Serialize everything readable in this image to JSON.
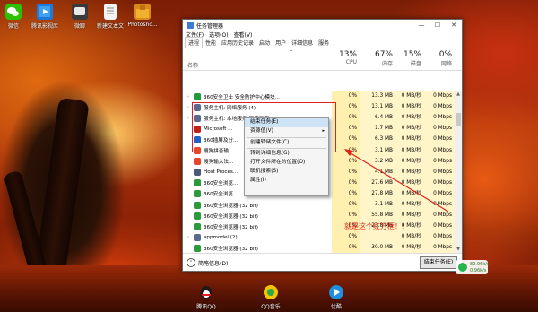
{
  "desktop": {
    "icons": [
      {
        "label": "微信",
        "icon": "wechat-icon",
        "color": "#2dc100"
      },
      {
        "label": "腾讯影视库",
        "icon": "video-library-icon",
        "color": "#1e7ad8"
      },
      {
        "label": "微聊",
        "icon": "chat-icon",
        "color": "#3a3a3a"
      },
      {
        "label": "新建文本文",
        "icon": "text-file-icon",
        "color": "#f4f4f4"
      },
      {
        "label": "Photosho...",
        "icon": "photoshop-icon",
        "color": "#d98a1a"
      },
      {
        "label": "腾讯QQ",
        "icon": "qq-icon",
        "color": "#1a1a1a"
      },
      {
        "label": "QQ音乐",
        "icon": "qq-music-icon",
        "color": "#f5c400"
      },
      {
        "label": "优酷",
        "icon": "youku-icon",
        "color": "#1f8fe0"
      }
    ]
  },
  "window": {
    "title": "任务管理器",
    "controls": {
      "minimize": "—",
      "maximize": "☐",
      "close": "✕"
    },
    "menu": [
      "文件(F)",
      "选项(O)",
      "查看(V)"
    ],
    "tabs": [
      {
        "label": "进程",
        "active": true
      },
      {
        "label": "性能",
        "active": false
      },
      {
        "label": "应用历史记录",
        "active": false
      },
      {
        "label": "启动",
        "active": false
      },
      {
        "label": "用户",
        "active": false
      },
      {
        "label": "详细信息",
        "active": false
      },
      {
        "label": "服务",
        "active": false
      }
    ]
  },
  "columns": {
    "name": "名称",
    "sort_indicator": "^",
    "cpu": {
      "percent": "13%",
      "label": "CPU"
    },
    "memory": {
      "percent": "67%",
      "label": "内存"
    },
    "disk": {
      "percent": "15%",
      "label": "磁盘"
    },
    "network": {
      "percent": "0%",
      "label": "网络"
    }
  },
  "processes": [
    {
      "expander": "›",
      "name": "360安全卫士 安全防护中心模块...",
      "icon": "360-shield-icon",
      "icon_color": "#1e9b3a",
      "cpu": "0%",
      "memory": "13.3 MB",
      "disk": "0 MB/秒",
      "network": "0 Mbps"
    },
    {
      "expander": "›",
      "name": "服务主机: 网络服务 (4)",
      "icon": "service-host-icon",
      "icon_color": "#5a6a8a",
      "cpu": "0%",
      "memory": "13.1 MB",
      "disk": "0 MB/秒",
      "network": "0 Mbps"
    },
    {
      "expander": "›",
      "name": "服务主机: 本地服务(网络受限) (7)",
      "icon": "service-host-icon",
      "icon_color": "#5a6a8a",
      "cpu": "0%",
      "memory": "6.4 MB",
      "disk": "0 MB/秒",
      "network": "0 Mbps"
    },
    {
      "expander": "",
      "name": "Microsoft ...",
      "icon": "red-app-icon",
      "icon_color": "#c0201a",
      "cpu": "0%",
      "memory": "1.7 MB",
      "disk": "0 MB/秒",
      "network": "0 Mbps"
    },
    {
      "expander": "",
      "name": "360插屏及分...",
      "icon": "360-blue-icon",
      "icon_color": "#1c62c8",
      "cpu": "0%",
      "memory": "6.3 MB",
      "disk": "0 MB/秒",
      "network": "0 Mbps"
    },
    {
      "expander": "",
      "name": "搜狗拼音输...",
      "icon": "sogou-icon",
      "icon_color": "#e8452a",
      "cpu": "0%",
      "memory": "3.1 MB",
      "disk": "0 MB/秒",
      "network": "0 Mbps"
    },
    {
      "expander": "",
      "name": "搜狗输入法...",
      "icon": "sogou-icon",
      "icon_color": "#e8452a",
      "cpu": "0%",
      "memory": "3.2 MB",
      "disk": "0 MB/秒",
      "network": "0 Mbps"
    },
    {
      "expander": "",
      "name": "Host Proces...",
      "icon": "host-process-icon",
      "icon_color": "#4a5a7a",
      "cpu": "0%",
      "memory": "4.1 MB",
      "disk": "0 MB/秒",
      "network": "0 Mbps"
    },
    {
      "expander": "",
      "name": "360安全浏览...",
      "icon": "360-browser-icon",
      "icon_color": "#2a9a3a",
      "cpu": "0%",
      "memory": "27.6 MB",
      "disk": "0 MB/秒",
      "network": "0 Mbps"
    },
    {
      "expander": "",
      "name": "360安全浏览...",
      "icon": "360-browser-icon",
      "icon_color": "#2a9a3a",
      "cpu": "0%",
      "memory": "27.8 MB",
      "disk": "0 MB/秒",
      "network": "0 Mbps"
    },
    {
      "expander": "",
      "name": "360安全浏览器 (32 bit)",
      "icon": "360-browser-icon",
      "icon_color": "#2a9a3a",
      "cpu": "0%",
      "memory": "3.1 MB",
      "disk": "0 MB/秒",
      "network": "0 Mbps"
    },
    {
      "expander": "",
      "name": "360安全浏览器 (32 bit)",
      "icon": "360-browser-icon",
      "icon_color": "#2a9a3a",
      "cpu": "0%",
      "memory": "55.8 MB",
      "disk": "0 MB/秒",
      "network": "0 Mbps"
    },
    {
      "expander": "",
      "name": "360安全浏览器 (32 bit)",
      "icon": "360-browser-icon",
      "icon_color": "#2a9a3a",
      "cpu": "0%",
      "memory": "23.8 MB",
      "disk": "0 MB/秒",
      "network": "0 Mbps"
    },
    {
      "expander": "›",
      "name": "appmodel (2)",
      "icon": "app-model-icon",
      "icon_color": "#5a6a8a",
      "cpu": "0%",
      "memory": "",
      "disk": "0 MB/秒",
      "network": "0 Mbps"
    },
    {
      "expander": "",
      "name": "360安全浏览器 (32 bit)",
      "icon": "360-browser-icon",
      "icon_color": "#2a9a3a",
      "cpu": "0%",
      "memory": "30.0 MB",
      "disk": "0 MB/秒",
      "network": "0 Mbps"
    }
  ],
  "context_menu": {
    "items": [
      {
        "label": "结束任务(E)",
        "highlighted": true,
        "submenu": false
      },
      {
        "label": "资源值(V)",
        "highlighted": false,
        "submenu": true
      },
      {
        "separator": true
      },
      {
        "label": "创建转储文件(C)",
        "highlighted": false,
        "submenu": false
      },
      {
        "separator": true
      },
      {
        "label": "转到详细信息(G)",
        "highlighted": false,
        "submenu": false
      },
      {
        "label": "打开文件所在的位置(O)",
        "highlighted": false,
        "submenu": false
      },
      {
        "label": "联机搜索(S)",
        "highlighted": false,
        "submenu": false
      },
      {
        "label": "属性(I)",
        "highlighted": false,
        "submenu": false
      }
    ]
  },
  "footer": {
    "less_details": "简略信息(D)",
    "end_task": "结束任务(E)"
  },
  "annotation": {
    "text": "就是这个红方框！！",
    "color": "#e0201a"
  },
  "system_monitor": {
    "line1": "89.96k/s",
    "line2": "0.96k/s"
  }
}
